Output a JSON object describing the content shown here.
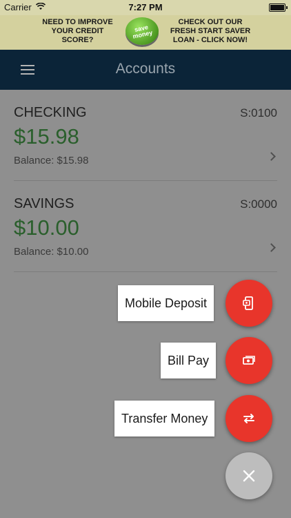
{
  "status_bar": {
    "carrier": "Carrier",
    "time": "7:27 PM"
  },
  "banner": {
    "left_text": "NEED TO IMPROVE\nYOUR CREDIT\nSCORE?",
    "button_text": "save money",
    "right_text": "CHECK OUT OUR\nFRESH START SAVER\nLOAN - CLICK NOW!"
  },
  "navbar": {
    "title": "Accounts",
    "menu_icon": "hamburger-menu-icon"
  },
  "accounts": [
    {
      "name": "CHECKING",
      "code": "S:0100",
      "amount": "$15.98",
      "balance": "Balance: $15.98"
    },
    {
      "name": "SAVINGS",
      "code": "S:0000",
      "amount": "$10.00",
      "balance": "Balance: $10.00"
    }
  ],
  "fab_menu": {
    "items": [
      {
        "label": "Mobile Deposit",
        "icon": "mobile-deposit-icon"
      },
      {
        "label": "Bill Pay",
        "icon": "bill-pay-icon"
      },
      {
        "label": "Transfer Money",
        "icon": "transfer-icon"
      }
    ],
    "close_icon": "close-icon"
  },
  "colors": {
    "navbar": "#0b2438",
    "fab": "#e8352b",
    "amount": "#2a5f2c"
  }
}
